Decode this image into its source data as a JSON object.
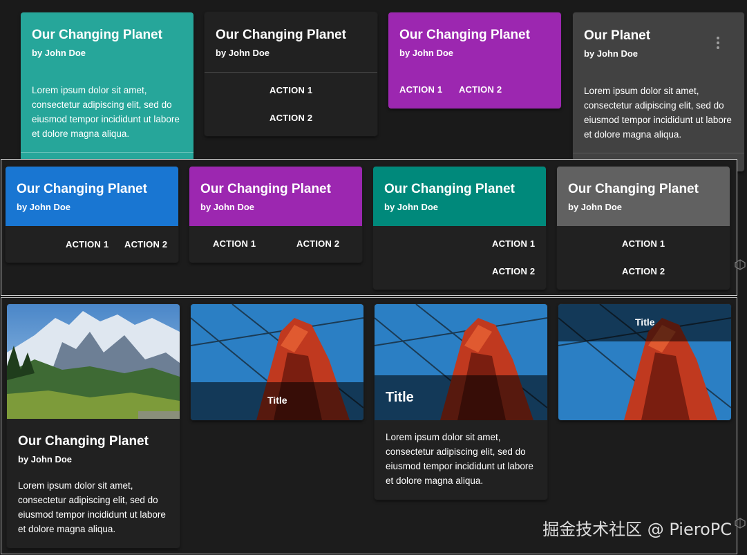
{
  "colors": {
    "teal": "#26a69a",
    "dark": "#212121",
    "purple": "#9c27b0",
    "grey": "#424242",
    "blue": "#1976d2",
    "green_teal": "#00897b",
    "mid_grey": "#616161"
  },
  "card_title": "Our Changing Planet",
  "card_title_short": "Our Planet",
  "card_subtitle": "by John Doe",
  "lorem": "Lorem ipsum dolor sit amet, consectetur adipiscing elit, sed do eiusmod tempor incididunt ut labore et dolore magna aliqua.",
  "action1": "ACTION 1",
  "action2": "ACTION 2",
  "image_title": "Title",
  "more_icon": "more-vert-icon",
  "watermark": "掘金技术社区 @ PieroPC"
}
